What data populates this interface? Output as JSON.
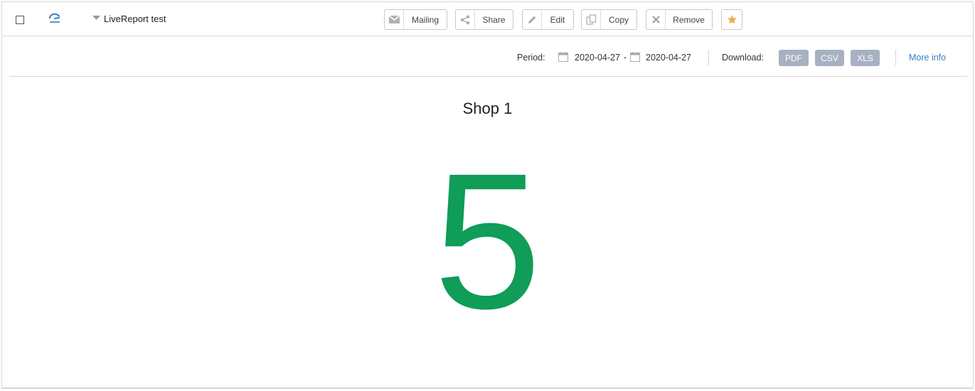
{
  "report": {
    "title": "LiveReport test"
  },
  "toolbar": {
    "mailing_label": "Mailing",
    "share_label": "Share",
    "edit_label": "Edit",
    "copy_label": "Copy",
    "remove_label": "Remove"
  },
  "options": {
    "period_label": "Period:",
    "date_from": "2020-04-27",
    "range_separator": "-",
    "date_to": "2020-04-27",
    "download_label": "Download:",
    "download_formats": [
      "PDF",
      "CSV",
      "XLS"
    ],
    "more_info_label": "More info"
  },
  "widget": {
    "shop_name": "Shop 1",
    "value": "5"
  },
  "colors": {
    "value_color": "#0f9d58",
    "link_color": "#3a7fc1",
    "download_button_bg": "#a7b1c2",
    "favorite_star": "#f0ad4e"
  },
  "icons": {
    "report_type": "gauge-icon",
    "mailing": "envelope-icon",
    "share": "share-icon",
    "edit": "pencil-icon",
    "copy": "copy-icon",
    "remove": "x-icon",
    "favorite": "star-icon",
    "calendar": "calendar-icon"
  }
}
